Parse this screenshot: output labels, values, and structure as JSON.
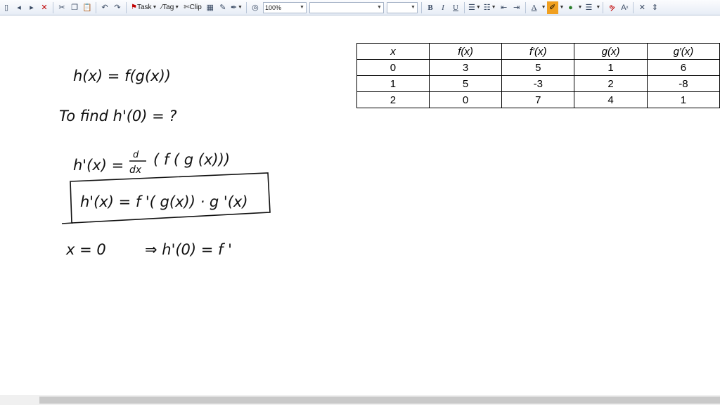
{
  "toolbar": {
    "task_label": "Task",
    "tag_label": "Tag",
    "clip_label": "Clip",
    "zoom_value": "100%",
    "font_name_value": "",
    "font_size_value": "",
    "bold_label": "B",
    "italic_label": "I",
    "underline_label": "U",
    "font_color_label": "A",
    "superscript_label": "A"
  },
  "notes": {
    "line1": "h(x) = f(g(x))",
    "line2": "To find  h'(0) = ?",
    "line3_lhs": "h'(x) =",
    "line3_num": "d",
    "line3_den": "dx",
    "line3_rhs": "( f ( g (x)))",
    "line4": "h'(x) =  f '( g(x)) · g '(x)",
    "line5_a": "x = 0",
    "line5_b": "⇒  h'(0) = f '"
  },
  "table": {
    "headers": [
      "x",
      "f(x)",
      "f′(x)",
      "g(x)",
      "g′(x)"
    ],
    "rows": [
      [
        "0",
        "3",
        "5",
        "1",
        "6"
      ],
      [
        "1",
        "5",
        "-3",
        "2",
        "-8"
      ],
      [
        "2",
        "0",
        "7",
        "4",
        "1"
      ]
    ]
  },
  "colors": {
    "toolbar_bg": "#e7edf6",
    "highlighter": "#f0a020",
    "ink": "#111111"
  }
}
